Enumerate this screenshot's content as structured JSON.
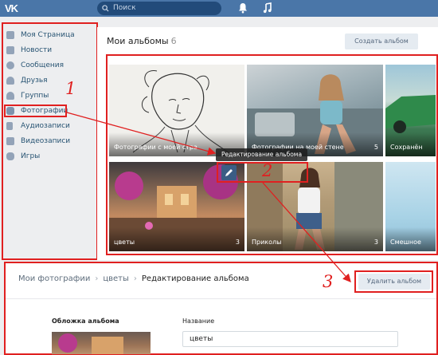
{
  "header": {
    "logo": "VK",
    "search_placeholder": "Поиск",
    "icons": [
      "search-icon",
      "bell-icon",
      "music-note-icon"
    ]
  },
  "sidebar": {
    "items": [
      {
        "label": "Моя Страница",
        "icon": "home-icon"
      },
      {
        "label": "Новости",
        "icon": "news-icon"
      },
      {
        "label": "Сообщения",
        "icon": "message-icon"
      },
      {
        "label": "Друзья",
        "icon": "person-icon"
      },
      {
        "label": "Группы",
        "icon": "group-icon"
      },
      {
        "label": "Фотографии",
        "icon": "camera-icon"
      },
      {
        "label": "Аудиозаписи",
        "icon": "music-icon"
      },
      {
        "label": "Видеозаписи",
        "icon": "video-icon"
      },
      {
        "label": "Игры",
        "icon": "game-icon"
      }
    ]
  },
  "albums": {
    "title": "Мои альбомы",
    "count": "6",
    "create_button": "Создать альбом",
    "tooltip": "Редактирование альбома",
    "items": [
      {
        "title": "Фотографии с моей стра",
        "count": ""
      },
      {
        "title": "Фотографии на моей стене",
        "count": "5"
      },
      {
        "title": "Сохранён",
        "count": ""
      },
      {
        "title": "цветы",
        "count": "3"
      },
      {
        "title": "Приколы",
        "count": "3"
      },
      {
        "title": "Смешное",
        "count": ""
      }
    ]
  },
  "annotations": {
    "step1": "1",
    "step2": "2",
    "step3": "3"
  },
  "edit_panel": {
    "breadcrumb": {
      "my_photos": "Мои фотографии",
      "album": "цветы",
      "current": "Редактирование альбома"
    },
    "delete_button": "Удалить альбом",
    "cover_label": "Обложка альбома",
    "name_label": "Название",
    "name_value": "цветы"
  },
  "colors": {
    "header": "#4a76a8",
    "annotation": "#e02020",
    "link": "#285473",
    "background": "#edeef0"
  }
}
